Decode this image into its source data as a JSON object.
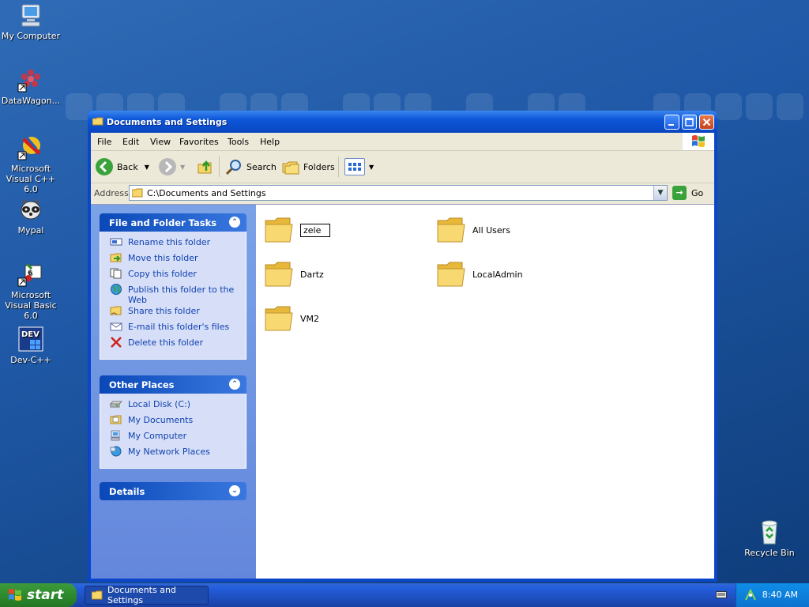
{
  "desktop": {
    "icons": [
      {
        "label": "My Computer"
      },
      {
        "label": "DataWagon..."
      },
      {
        "label": "Microsoft Visual C++ 6.0"
      },
      {
        "label": "Mypal"
      },
      {
        "label": "Microsoft Visual Basic 6.0"
      },
      {
        "label": "Dev-C++"
      },
      {
        "label": "Recycle Bin"
      }
    ]
  },
  "window": {
    "title": "Documents and Settings",
    "menu": [
      "File",
      "Edit",
      "View",
      "Favorites",
      "Tools",
      "Help"
    ],
    "toolbar": {
      "back": "Back",
      "search": "Search",
      "folders": "Folders"
    },
    "address": {
      "label": "Address",
      "value": "C:\\Documents and Settings",
      "go": "Go"
    },
    "panels": {
      "tasks": {
        "title": "File and Folder Tasks",
        "items": [
          "Rename this folder",
          "Move this folder",
          "Copy this folder",
          "Publish this folder to the Web",
          "Share this folder",
          "E-mail this folder's files",
          "Delete this folder"
        ]
      },
      "places": {
        "title": "Other Places",
        "items": [
          "Local Disk (C:)",
          "My Documents",
          "My Computer",
          "My Network Places"
        ]
      },
      "details": {
        "title": "Details"
      }
    },
    "files": {
      "editing": "zele",
      "items": [
        "All Users",
        "Dartz",
        "LocalAdmin",
        "VM2"
      ]
    }
  },
  "taskbar": {
    "start": "start",
    "task": "Documents and Settings",
    "clock": "8:40 AM"
  },
  "colors": {
    "titlebar": "#0a46c8",
    "start": "#2e8a2e",
    "link": "#1040b0"
  }
}
